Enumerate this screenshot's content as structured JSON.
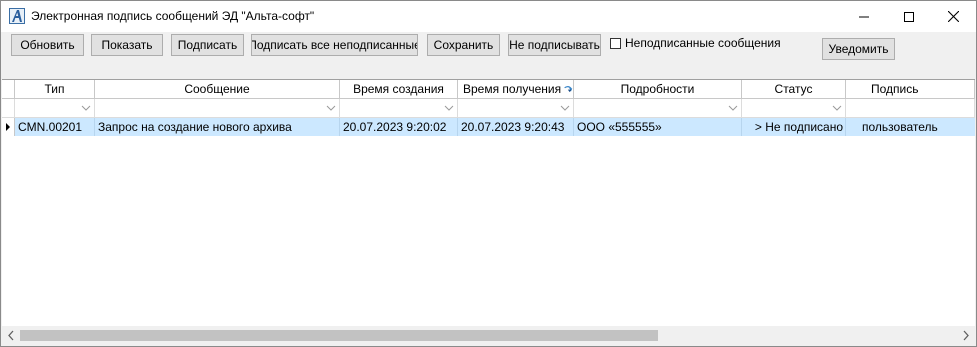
{
  "window": {
    "title": "Электронная подпись сообщений ЭД \"Альта-софт\""
  },
  "toolbar": {
    "refresh_label": "Обновить",
    "show_label": "Показать",
    "sign_label": "Подписать",
    "sign_all_label": "Подписать все неподписанные",
    "save_label": "Сохранить",
    "dont_sign_label": "Не подписывать",
    "unsigned_filter_label": "Неподписанные сообщения",
    "unsigned_filter_checked": false,
    "notify_label": "Уведомить"
  },
  "grid": {
    "columns": [
      "Тип",
      "Сообщение",
      "Время создания",
      "Время получения",
      "Подробности",
      "Статус",
      "Подпись"
    ],
    "sorted_column": "Время получения",
    "rows": [
      {
        "type": "CMN.00201",
        "message": "Запрос на создание нового архива",
        "created": "20.07.2023 9:20:02",
        "received": "20.07.2023 9:20:43",
        "details": "ООО «555555»",
        "status": "> Не подписано",
        "signature": "пользователь",
        "selected": true
      }
    ]
  },
  "colors": {
    "selection": "#cce8ff",
    "button_face": "#e1e1e1",
    "window_bg": "#f0f0f0"
  }
}
